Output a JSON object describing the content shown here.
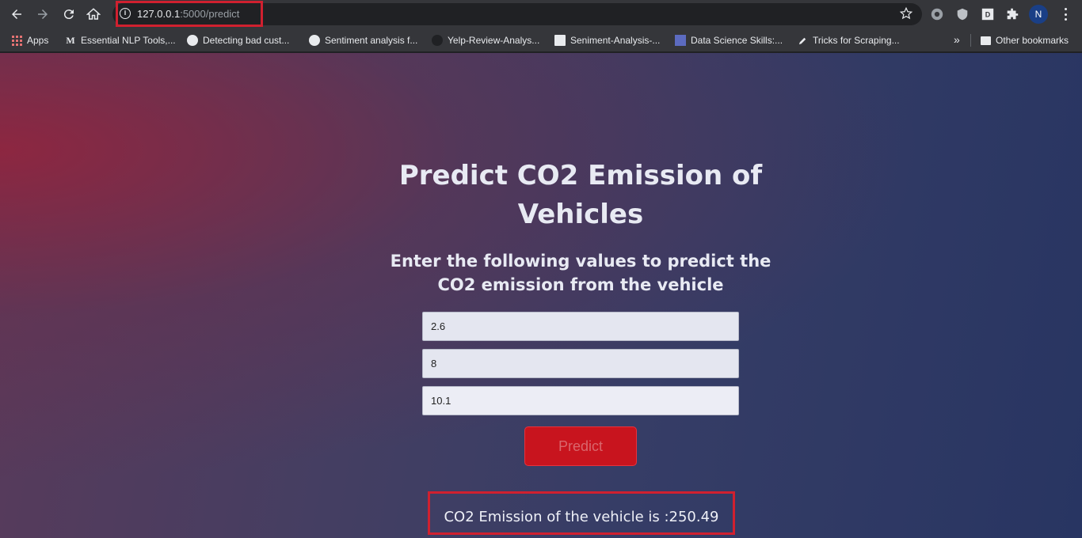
{
  "browser": {
    "url_host": "127.0.0.1",
    "url_path": ":5000/predict",
    "profile_initial": "N",
    "bookmarks": [
      {
        "label": "Apps",
        "icon": "apps-grid-icon"
      },
      {
        "label": "Essential NLP Tools,...",
        "icon": "medium-icon"
      },
      {
        "label": "Detecting bad cust...",
        "icon": "globe-icon"
      },
      {
        "label": "Sentiment analysis f...",
        "icon": "globe-icon"
      },
      {
        "label": "Yelp-Review-Analys...",
        "icon": "github-icon"
      },
      {
        "label": "Seniment-Analysis-...",
        "icon": "document-icon"
      },
      {
        "label": "Data Science Skills:...",
        "icon": "site-icon"
      },
      {
        "label": "Tricks for Scraping...",
        "icon": "pencil-icon"
      }
    ],
    "more_bookmarks": "»",
    "other_bookmarks": "Other bookmarks"
  },
  "page": {
    "title": "Predict CO2 Emission of Vehicles",
    "subtitle": "Enter the following values to predict the CO2 emission from the vehicle",
    "inputs": [
      {
        "value": "2.6"
      },
      {
        "value": "8"
      },
      {
        "value": "10.1"
      }
    ],
    "predict_label": "Predict",
    "result": "CO2 Emission of the vehicle is :250.49"
  },
  "colors": {
    "highlight": "#d0202f",
    "button": "#c8141e",
    "toolbar": "#35363a"
  }
}
